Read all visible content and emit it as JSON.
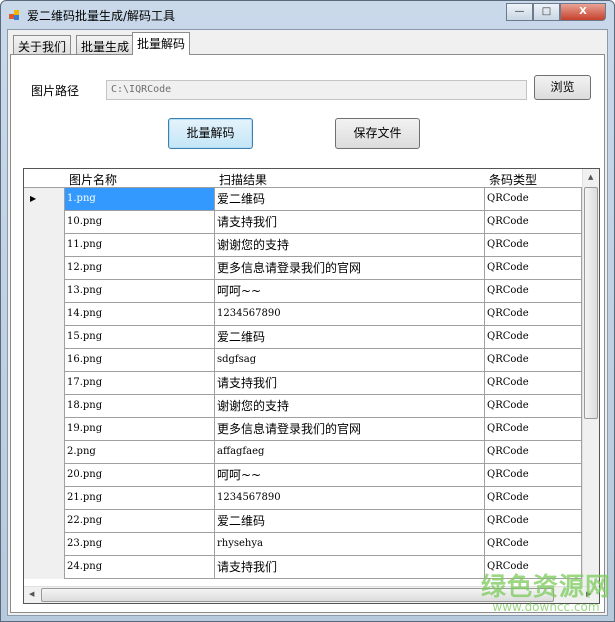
{
  "window": {
    "title": "爱二维码批量生成/解码工具",
    "minimize": "—",
    "maximize": "□",
    "close": "X"
  },
  "tabs": [
    {
      "label": "关于我们"
    },
    {
      "label": "批量生成"
    },
    {
      "label": "批量解码",
      "active": true
    }
  ],
  "form": {
    "path_label": "图片路径",
    "path_value": "C:\\IQRCode",
    "browse": "浏览",
    "decode": "批量解码",
    "save": "保存文件"
  },
  "grid": {
    "columns": [
      "图片名称",
      "扫描结果",
      "条码类型"
    ],
    "rows": [
      [
        "1.png",
        "爱二维码",
        "QRCode"
      ],
      [
        "10.png",
        "请支持我们",
        "QRCode"
      ],
      [
        "11.png",
        "谢谢您的支持",
        "QRCode"
      ],
      [
        "12.png",
        "更多信息请登录我们的官网",
        "QRCode"
      ],
      [
        "13.png",
        "呵呵~~",
        "QRCode"
      ],
      [
        "14.png",
        "1234567890",
        "QRCode"
      ],
      [
        "15.png",
        "爱二维码",
        "QRCode"
      ],
      [
        "16.png",
        "sdgfsag",
        "QRCode"
      ],
      [
        "17.png",
        "请支持我们",
        "QRCode"
      ],
      [
        "18.png",
        "谢谢您的支持",
        "QRCode"
      ],
      [
        "19.png",
        "更多信息请登录我们的官网",
        "QRCode"
      ],
      [
        "2.png",
        "affagfaeg",
        "QRCode"
      ],
      [
        "20.png",
        "呵呵~~",
        "QRCode"
      ],
      [
        "21.png",
        "1234567890",
        "QRCode"
      ],
      [
        "22.png",
        "爱二维码",
        "QRCode"
      ],
      [
        "23.png",
        "rhysehya",
        "QRCode"
      ],
      [
        "24.png",
        "请支持我们",
        "QRCode"
      ]
    ],
    "current_row_icon": "row-pointer-icon"
  },
  "watermark": {
    "name": "绿色资源网",
    "url": "www.downcc.com"
  }
}
